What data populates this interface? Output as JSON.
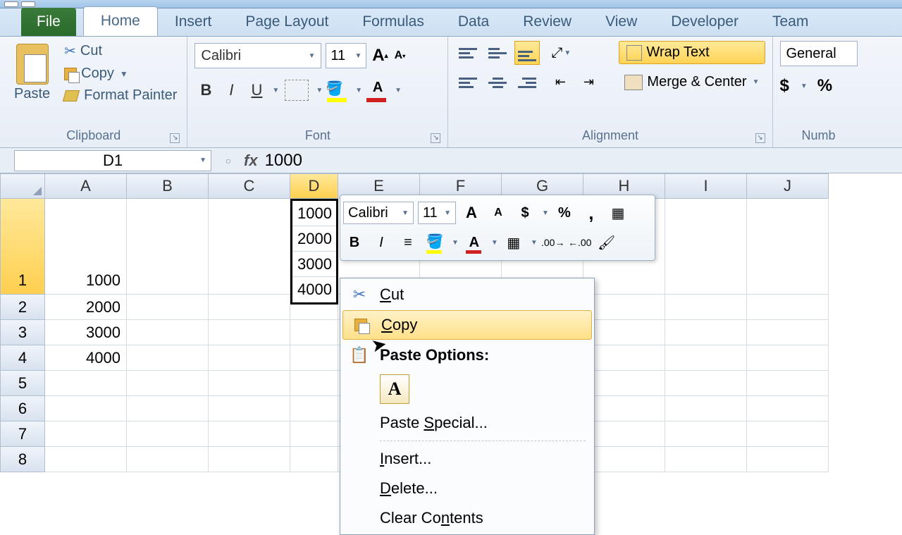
{
  "tabs": {
    "file": "File",
    "home": "Home",
    "insert": "Insert",
    "page_layout": "Page Layout",
    "formulas": "Formulas",
    "data": "Data",
    "review": "Review",
    "view": "View",
    "developer": "Developer",
    "team": "Team"
  },
  "clipboard": {
    "paste": "Paste",
    "cut": "Cut",
    "copy": "Copy",
    "format_painter": "Format Painter",
    "group_label": "Clipboard"
  },
  "font": {
    "name": "Calibri",
    "size": "11",
    "group_label": "Font"
  },
  "alignment": {
    "wrap_text": "Wrap Text",
    "merge_center": "Merge & Center",
    "group_label": "Alignment"
  },
  "number": {
    "format": "General",
    "group_label": "Numb"
  },
  "namebox": "D1",
  "formula": "1000",
  "columns": [
    "A",
    "B",
    "C",
    "D",
    "E",
    "F",
    "G",
    "H",
    "I",
    "J"
  ],
  "row_labels": [
    "1",
    "2",
    "3",
    "4",
    "5",
    "6",
    "7",
    "8"
  ],
  "col_a_values": [
    "1000",
    "2000",
    "3000",
    "4000"
  ],
  "d_stack": [
    "1000",
    "2000",
    "3000",
    "4000"
  ],
  "mini": {
    "font": "Calibri",
    "size": "11"
  },
  "ctx": {
    "cut": "Cut",
    "copy": "Copy",
    "paste_options": "Paste Options:",
    "paste_special": "Paste Special...",
    "insert": "Insert...",
    "delete": "Delete...",
    "clear": "Clear Contents"
  }
}
